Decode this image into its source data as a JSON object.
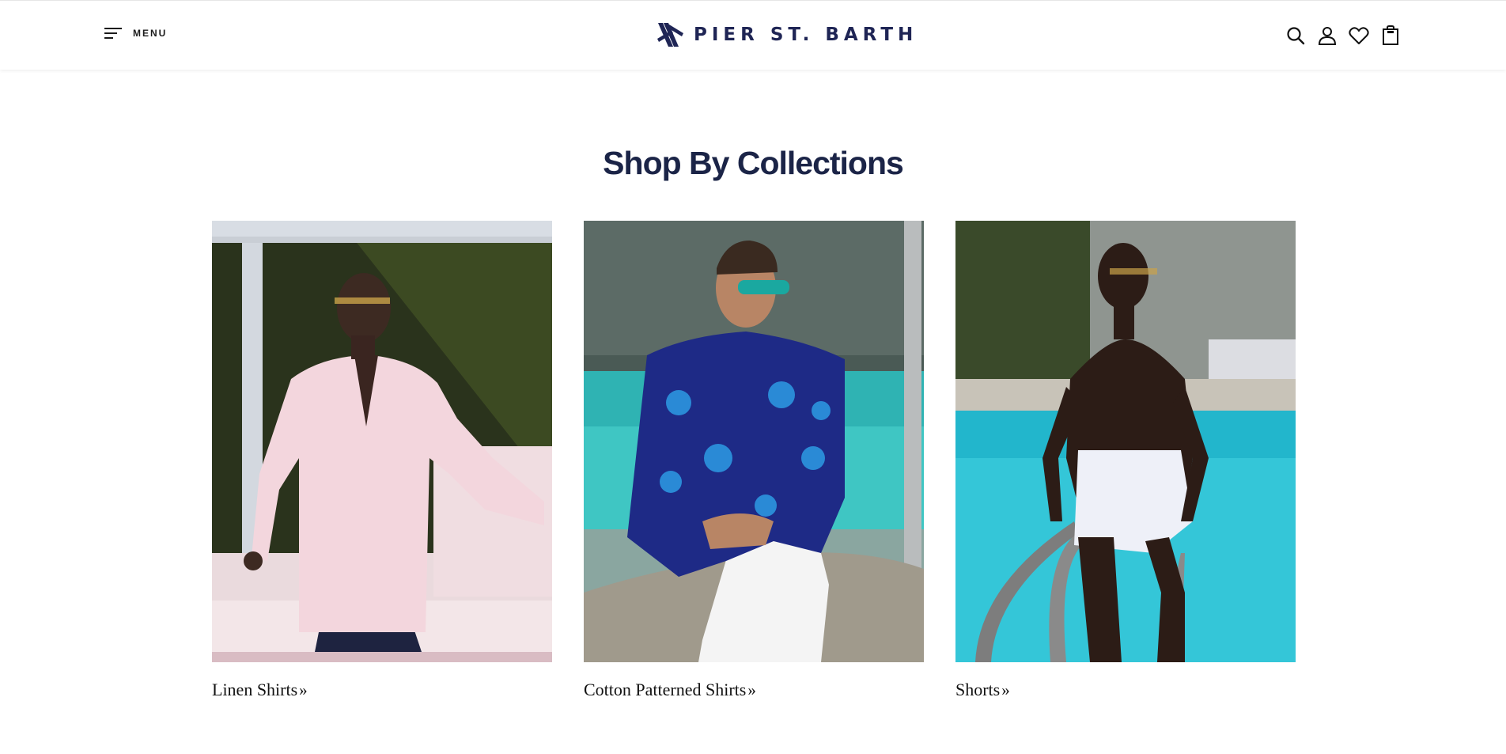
{
  "header": {
    "menu_label": "MENU",
    "brand": "PIER ST. BARTH",
    "icons": [
      "search-icon",
      "account-icon",
      "wishlist-icon",
      "cart-icon"
    ]
  },
  "section": {
    "title": "Shop By Collections"
  },
  "collections": [
    {
      "label": "Linen Shirts",
      "arrow": "»"
    },
    {
      "label": "Cotton Patterned Shirts",
      "arrow": "»"
    },
    {
      "label": "Shorts",
      "arrow": "»"
    }
  ],
  "colors": {
    "brand_navy": "#1f2555",
    "title_navy": "#1b2447"
  }
}
